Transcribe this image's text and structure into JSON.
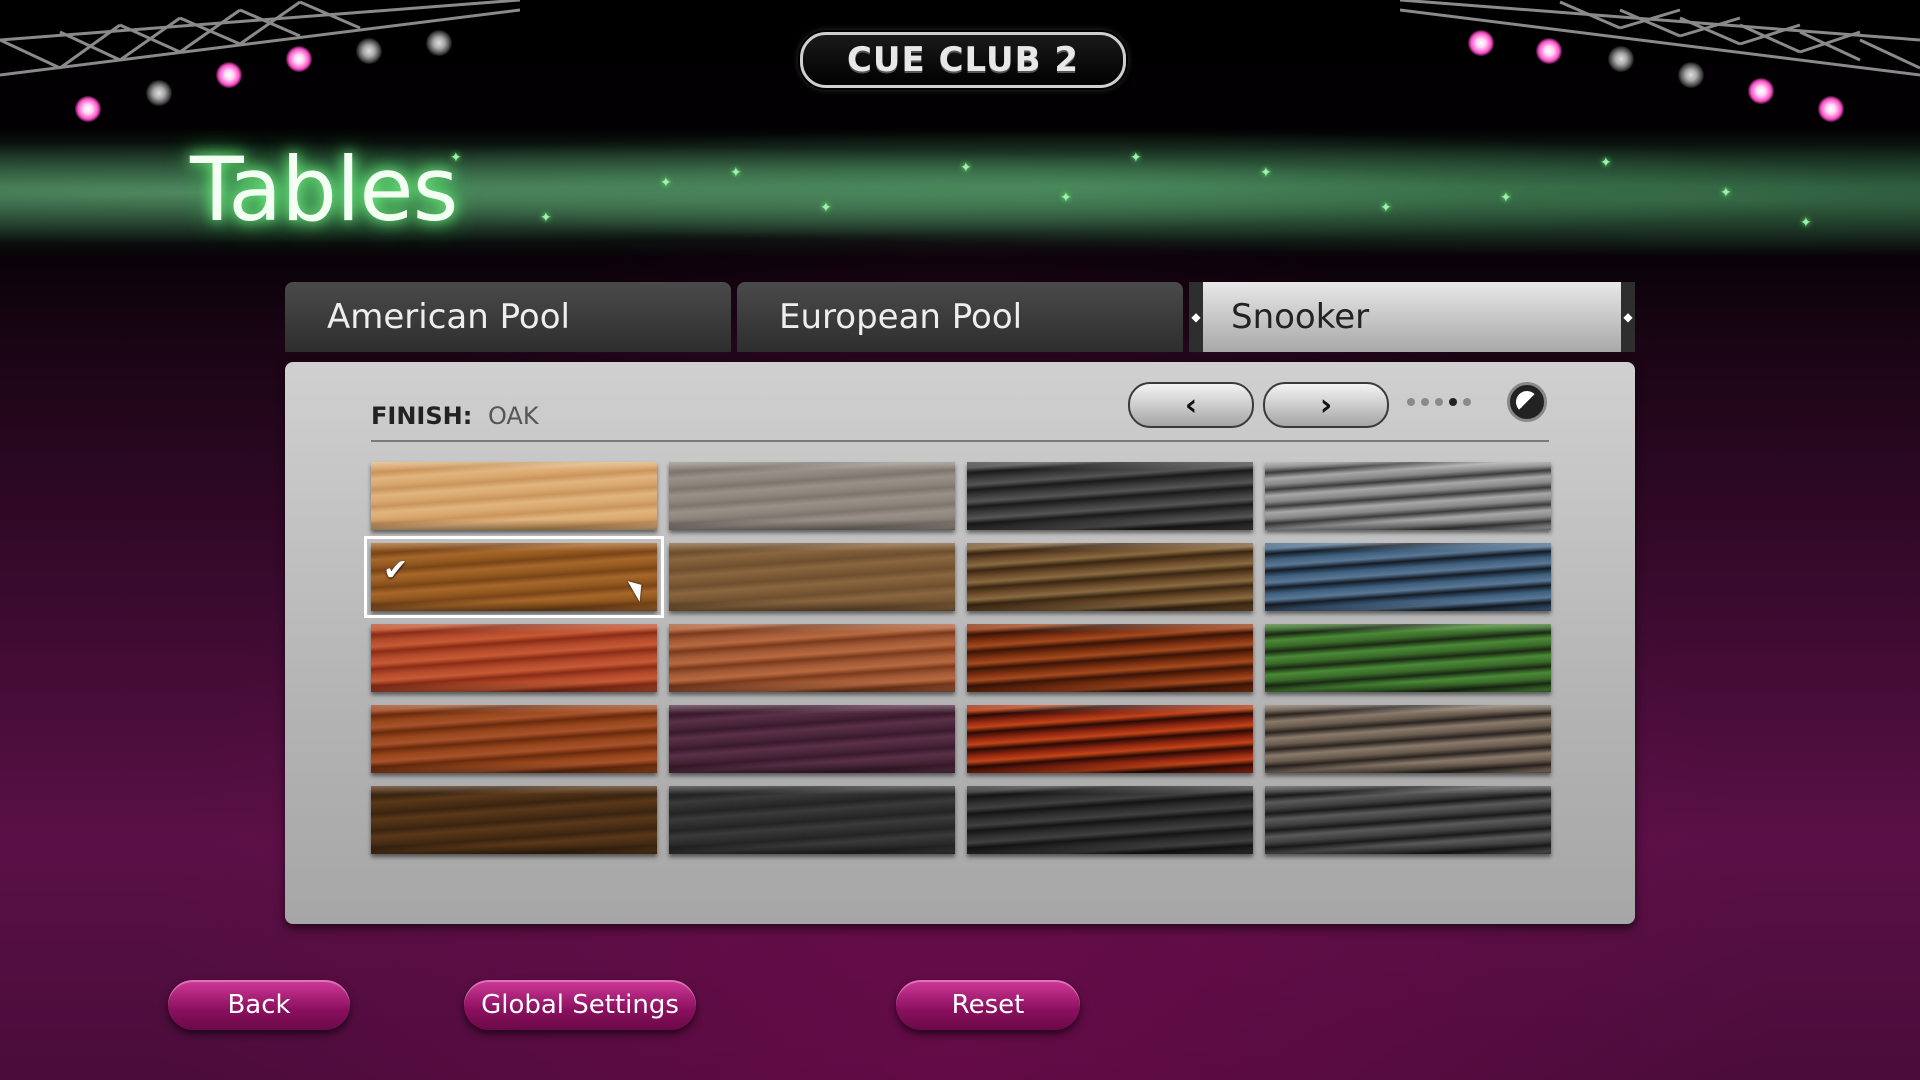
{
  "logo_text": "CUE CLUB 2",
  "title": "Tables",
  "tabs": [
    {
      "label": "American Pool"
    },
    {
      "label": "European Pool"
    },
    {
      "label": "Snooker",
      "active": true
    }
  ],
  "finish": {
    "label": "FINISH:",
    "value": "OAK"
  },
  "nav": {
    "prev_icon": "chevron-left-icon",
    "next_icon": "chevron-right-icon",
    "page_dots": 5,
    "current_page": 4
  },
  "swatches": [
    {
      "name": "light-oak",
      "colors": [
        "#e2b47e",
        "#c9955c",
        "#d9a86f"
      ]
    },
    {
      "name": "grey-wood",
      "colors": [
        "#9a9088",
        "#7e756d",
        "#8e857c"
      ]
    },
    {
      "name": "black-marble",
      "colors": [
        "#3a3a3a",
        "#1a1a1a",
        "#555"
      ]
    },
    {
      "name": "grey-granite",
      "colors": [
        "#a8a8a8",
        "#3c3c3c",
        "#888"
      ]
    },
    {
      "name": "oak",
      "colors": [
        "#a7672a",
        "#7a4518",
        "#94591f"
      ],
      "selected": true
    },
    {
      "name": "walnut-light",
      "colors": [
        "#8a6640",
        "#6e4f2f",
        "#7c5a36"
      ]
    },
    {
      "name": "brown-marble",
      "colors": [
        "#6a4a2a",
        "#3a2612",
        "#8a6a40"
      ]
    },
    {
      "name": "blue-granite",
      "colors": [
        "#3e5f7e",
        "#141c26",
        "#5a7896"
      ]
    },
    {
      "name": "cherry",
      "colors": [
        "#b44a2c",
        "#8a2c16",
        "#c75a34"
      ]
    },
    {
      "name": "rosewood",
      "colors": [
        "#a35a36",
        "#7a3a1c",
        "#b86a40"
      ]
    },
    {
      "name": "red-brown-marble",
      "colors": [
        "#7a2e10",
        "#3a1406",
        "#a64a1e"
      ]
    },
    {
      "name": "green-granite",
      "colors": [
        "#4a8a36",
        "#1a2a14",
        "#3a6a2a"
      ]
    },
    {
      "name": "mahogany",
      "colors": [
        "#98461c",
        "#6a2a0c",
        "#a8522a"
      ]
    },
    {
      "name": "purple-wood",
      "colors": [
        "#5a3048",
        "#3a1a2c",
        "#4a2639"
      ]
    },
    {
      "name": "red-marble",
      "colors": [
        "#8a2410",
        "#2a0a04",
        "#c24418"
      ]
    },
    {
      "name": "brown-granite",
      "colors": [
        "#8a7a6a",
        "#2a2420",
        "#6a5c4e"
      ]
    },
    {
      "name": "dark-walnut",
      "colors": [
        "#5a3818",
        "#3a2410",
        "#4a2e14"
      ]
    },
    {
      "name": "black-wood",
      "colors": [
        "#3a3a3a",
        "#242424",
        "#2e2e2e"
      ]
    },
    {
      "name": "dark-marble",
      "colors": [
        "#2e2e2e",
        "#141414",
        "#404040"
      ]
    },
    {
      "name": "black-granite",
      "colors": [
        "#5a5a5a",
        "#1a1a1a",
        "#404040"
      ]
    }
  ],
  "buttons": {
    "back": "Back",
    "global_settings": "Global Settings",
    "reset": "Reset"
  }
}
